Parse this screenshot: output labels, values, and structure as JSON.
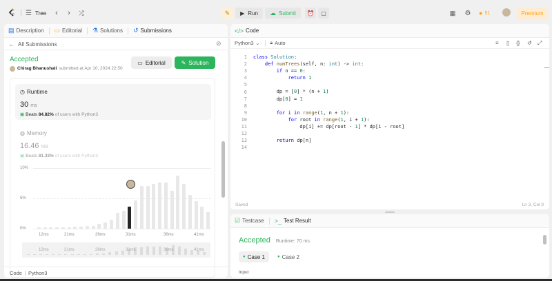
{
  "topbar": {
    "problem_list": "Tree",
    "run": "Run",
    "submit": "Submit",
    "streak": "51",
    "premium": "Premium"
  },
  "left_tabs": [
    {
      "label": "Description"
    },
    {
      "label": "Editorial"
    },
    {
      "label": "Solutions"
    },
    {
      "label": "Submissions"
    }
  ],
  "submission": {
    "back": "All Submissions",
    "status": "Accepted",
    "user": "Chirag Bhanushali",
    "submitted": "submitted at Apr 10, 2024 22:50",
    "editorial_btn": "Editorial",
    "solution_btn": "Solution"
  },
  "runtime": {
    "title": "Runtime",
    "value": "30",
    "unit": "ms",
    "beats_prefix": "Beats",
    "beats_pct": "84.82%",
    "beats_suffix": "of users with Python3"
  },
  "memory": {
    "title": "Memory",
    "value": "16.46",
    "unit": "MB",
    "beats_prefix": "Beats",
    "beats_pct": "81.33%",
    "beats_suffix": "of users with Python3"
  },
  "chart_data": {
    "type": "bar",
    "yticks": [
      "10%",
      "5%",
      "0%"
    ],
    "ylim": [
      0,
      10
    ],
    "xticks": [
      "12ms",
      "21ms",
      "26ms",
      "31ms",
      "36ms",
      "41ms"
    ],
    "values": [
      0.2,
      0.2,
      0.2,
      0.2,
      0.2,
      0.2,
      0.3,
      0.3,
      0.4,
      0.5,
      0.8,
      1.0,
      1.5,
      2.6,
      3.0,
      3.6,
      4.7,
      7.0,
      7.0,
      7.4,
      7.6,
      7.6,
      6.2,
      8.7,
      7.4,
      5.6,
      4.6,
      3.6,
      2.7
    ],
    "highlight_index": 15
  },
  "mini_chart": {
    "xticks": [
      "12ms",
      "21ms",
      "26ms",
      "31ms",
      "36ms",
      "41ms"
    ]
  },
  "left_footer": {
    "code": "Code",
    "lang": "Python3"
  },
  "code_panel": {
    "title": "Code",
    "lang": "Python3",
    "auto": "Auto",
    "saved": "Saved",
    "cursor": "Ln 3, Col 9",
    "line_numbers": [
      "1",
      "2",
      "3",
      "4",
      "5",
      "6",
      "7",
      "8",
      "9",
      "10",
      "11",
      "12",
      "13",
      "14"
    ]
  },
  "result_panel": {
    "tab_testcase": "Testcase",
    "tab_result": "Test Result",
    "status": "Accepted",
    "runtime": "Runtime: 70 ms",
    "case1": "Case 1",
    "case2": "Case 2",
    "input_label": "Input"
  },
  "colors": {
    "accepted": "#2db55d",
    "accent": "#ffa116",
    "tab_active": "#1a73e8"
  }
}
